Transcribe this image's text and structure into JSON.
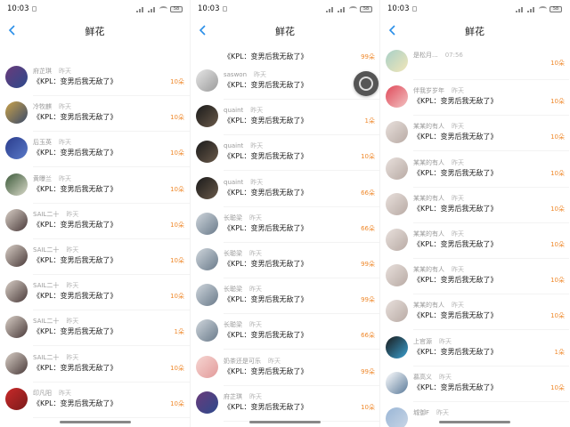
{
  "page_title": "鲜花",
  "colors": {
    "amount": "#ef8a2e",
    "meta": "#9a9a9a",
    "title": "#222222"
  },
  "panels": [
    {
      "status": {
        "time": "10:03",
        "battery": "58"
      },
      "rows": [
        {
          "name": "府芷琪",
          "time": "昨天",
          "msg": "《KPL：变男后我无敌了》",
          "amount": "10朵",
          "avatar": [
            "#6a3a7a",
            "#2c4a8c"
          ]
        },
        {
          "name": "冷牧麒",
          "time": "昨天",
          "msg": "《KPL：变男后我无敌了》",
          "amount": "10朵",
          "avatar": [
            "#c9a24a",
            "#3a4a6a"
          ]
        },
        {
          "name": "后玉英",
          "time": "昨天",
          "msg": "《KPL：变男后我无敌了》",
          "amount": "10朵",
          "avatar": [
            "#2a3c8c",
            "#5a7ac9"
          ]
        },
        {
          "name": "黄曝兰",
          "time": "昨天",
          "msg": "《KPL：变男后我无敌了》",
          "amount": "10朵",
          "avatar": [
            "#3c5a3a",
            "#d9d9c9"
          ]
        },
        {
          "name": "SAIL二十",
          "time": "昨天",
          "msg": "《KPL：变男后我无敌了》",
          "amount": "10朵",
          "avatar": [
            "#d8cfc6",
            "#4a3a3a"
          ]
        },
        {
          "name": "SAIL二十",
          "time": "昨天",
          "msg": "《KPL：变男后我无敌了》",
          "amount": "10朵",
          "avatar": [
            "#d8cfc6",
            "#4a3a3a"
          ]
        },
        {
          "name": "SAIL二十",
          "time": "昨天",
          "msg": "《KPL：变男后我无敌了》",
          "amount": "10朵",
          "avatar": [
            "#d8cfc6",
            "#4a3a3a"
          ]
        },
        {
          "name": "SAIL二十",
          "time": "昨天",
          "msg": "《KPL：变男后我无敌了》",
          "amount": "1朵",
          "avatar": [
            "#d8cfc6",
            "#4a3a3a"
          ]
        },
        {
          "name": "SAIL二十",
          "time": "昨天",
          "msg": "《KPL：变男后我无敌了》",
          "amount": "10朵",
          "avatar": [
            "#d8cfc6",
            "#4a3a3a"
          ]
        },
        {
          "name": "印凡阳",
          "time": "昨天",
          "msg": "《KPL：变男后我无敌了》",
          "amount": "10朵",
          "avatar": [
            "#c92a2a",
            "#7a1a1a"
          ]
        }
      ]
    },
    {
      "status": {
        "time": "10:03",
        "battery": "58"
      },
      "rows": [
        {
          "name": "saswon",
          "time": "昨天",
          "msg": "《KPL：变男后我无敌了》",
          "amount": "",
          "avatar": [
            "#e6e6e6",
            "#9a9a9a"
          ]
        },
        {
          "name": "quaint",
          "time": "昨天",
          "msg": "《KPL：变男后我无敌了》",
          "amount": "1朵",
          "avatar": [
            "#1a1a1a",
            "#6a5a4a"
          ]
        },
        {
          "name": "quaint",
          "time": "昨天",
          "msg": "《KPL：变男后我无敌了》",
          "amount": "10朵",
          "avatar": [
            "#1a1a1a",
            "#6a5a4a"
          ]
        },
        {
          "name": "quaint",
          "time": "昨天",
          "msg": "《KPL：变男后我无敌了》",
          "amount": "66朵",
          "avatar": [
            "#1a1a1a",
            "#6a5a4a"
          ]
        },
        {
          "name": "长聪梁",
          "time": "昨天",
          "msg": "《KPL：变男后我无敌了》",
          "amount": "66朵",
          "avatar": [
            "#cfd6dc",
            "#6a7a8a"
          ]
        },
        {
          "name": "长聪梁",
          "time": "昨天",
          "msg": "《KPL：变男后我无敌了》",
          "amount": "99朵",
          "avatar": [
            "#cfd6dc",
            "#6a7a8a"
          ]
        },
        {
          "name": "长聪梁",
          "time": "昨天",
          "msg": "《KPL：变男后我无敌了》",
          "amount": "99朵",
          "avatar": [
            "#cfd6dc",
            "#6a7a8a"
          ]
        },
        {
          "name": "长聪梁",
          "time": "昨天",
          "msg": "《KPL：变男后我无敌了》",
          "amount": "66朵",
          "avatar": [
            "#cfd6dc",
            "#6a7a8a"
          ]
        },
        {
          "name": "奶茶还是可乐",
          "time": "昨天",
          "msg": "《KPL：变男后我无敌了》",
          "amount": "99朵",
          "avatar": [
            "#f6d6d2",
            "#e29a9a"
          ]
        },
        {
          "name": "府芷琪",
          "time": "昨天",
          "msg": "《KPL：变男后我无敌了》",
          "amount": "10朵",
          "avatar": [
            "#6a3a7a",
            "#2c4a8c"
          ]
        }
      ],
      "top_partial": {
        "msg": "《KPL：变男后我无敌了》",
        "amount": "99朵"
      }
    },
    {
      "status": {
        "time": "10:03",
        "battery": "58"
      },
      "rows": [
        {
          "name": "是松月...",
          "time": "07:56",
          "msg": "",
          "amount": "10朵",
          "avatar": [
            "#a8d0c8",
            "#f2e6b8"
          ]
        },
        {
          "name": "伴我岁岁年",
          "time": "昨天",
          "msg": "《KPL：变男后我无敌了》",
          "amount": "10朵",
          "avatar": [
            "#e04a5a",
            "#f2c2c2"
          ]
        },
        {
          "name": "某某的有人",
          "time": "昨天",
          "msg": "《KPL：变男后我无敌了》",
          "amount": "10朵",
          "avatar": [
            "#e8e0dc",
            "#b8aaa4"
          ]
        },
        {
          "name": "某某的有人",
          "time": "昨天",
          "msg": "《KPL：变男后我无敌了》",
          "amount": "10朵",
          "avatar": [
            "#e8e0dc",
            "#b8aaa4"
          ]
        },
        {
          "name": "某某的有人",
          "time": "昨天",
          "msg": "《KPL：变男后我无敌了》",
          "amount": "10朵",
          "avatar": [
            "#e8e0dc",
            "#b8aaa4"
          ]
        },
        {
          "name": "某某的有人",
          "time": "昨天",
          "msg": "《KPL：变男后我无敌了》",
          "amount": "10朵",
          "avatar": [
            "#e8e0dc",
            "#b8aaa4"
          ]
        },
        {
          "name": "某某的有人",
          "time": "昨天",
          "msg": "《KPL：变男后我无敌了》",
          "amount": "10朵",
          "avatar": [
            "#e8e0dc",
            "#b8aaa4"
          ]
        },
        {
          "name": "某某的有人",
          "time": "昨天",
          "msg": "《KPL：变男后我无敌了》",
          "amount": "10朵",
          "avatar": [
            "#e8e0dc",
            "#b8aaa4"
          ]
        },
        {
          "name": "上官源",
          "time": "昨天",
          "msg": "《KPL：变男后我无敌了》",
          "amount": "1朵",
          "avatar": [
            "#1a1a1a",
            "#3aa0d0"
          ]
        },
        {
          "name": "慕高义",
          "time": "昨天",
          "msg": "《KPL：变男后我无敌了》",
          "amount": "10朵",
          "avatar": [
            "#ffffff",
            "#5a7a9a"
          ]
        },
        {
          "name": "城御F",
          "time": "昨天",
          "msg": "",
          "amount": "",
          "avatar": [
            "#9ab6d6",
            "#c9d6e6"
          ]
        }
      ]
    }
  ]
}
